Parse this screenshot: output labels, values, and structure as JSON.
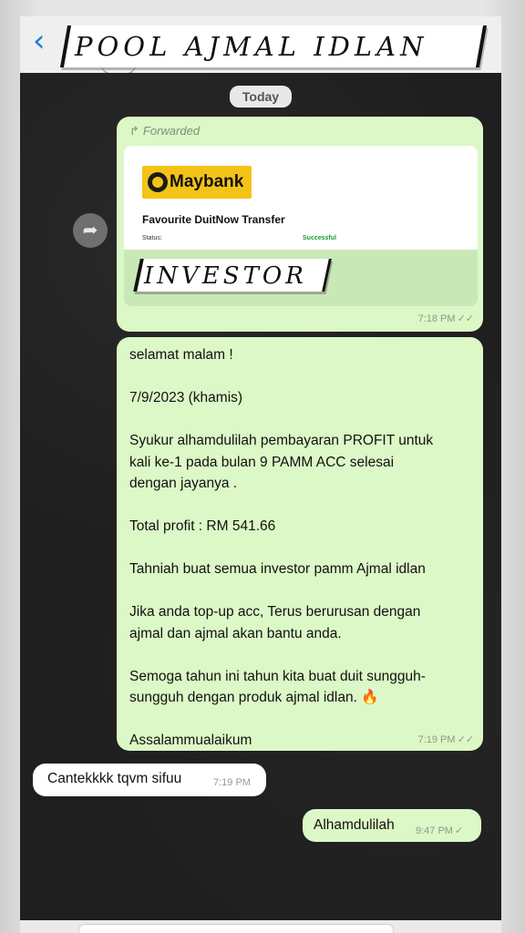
{
  "header": {
    "title": "POOL AJMAL IDLAN"
  },
  "chat": {
    "date_label": "Today",
    "forwarded_message": {
      "forwarded_label": "Forwarded",
      "receipt": {
        "bank_name": "Maybank",
        "title": "Favourite DuitNow Transfer",
        "status_label": "Status:",
        "status_value": "Successful"
      },
      "overlay_label": "INVESTOR",
      "time": "7:18 PM",
      "ticks": "✓✓"
    },
    "long_message": {
      "lines": [
        "selamat malam !",
        "",
        "7/9/2023 (khamis)",
        "",
        "Syukur alhamdulilah pembayaran PROFIT untuk",
        "kali ke-1 pada bulan 9 PAMM ACC selesai",
        "dengan jayanya .",
        "",
        "Total profit : RM 541.66",
        "",
        "Tahniah buat semua investor pamm Ajmal idlan",
        "",
        "Jika anda top-up acc, Terus berurusan dengan",
        "ajmal dan ajmal akan bantu anda.",
        "",
        "Semoga tahun ini tahun kita buat duit sungguh-",
        "sungguh dengan produk ajmal idlan. 🔥",
        "",
        "Assalammualaikum"
      ],
      "time": "7:19 PM",
      "ticks": "✓✓"
    },
    "incoming_message": {
      "text": "Cantekkkk tqvm sifuu",
      "time": "7:19 PM"
    },
    "reply_message": {
      "text": "Alhamdulilah",
      "time": "9:47 PM",
      "ticks": "✓"
    }
  },
  "icons": {
    "back": "chevron-left-icon",
    "forward": "share-arrow-icon",
    "forwarded": "forward-arrow-icon"
  },
  "colors": {
    "outgoing_bubble": "#dcf8c6",
    "incoming_bubble": "#ffffff",
    "chat_background": "#1f1f1f",
    "accent": "#1f7ae0",
    "maybank_yellow": "#f3c417"
  }
}
